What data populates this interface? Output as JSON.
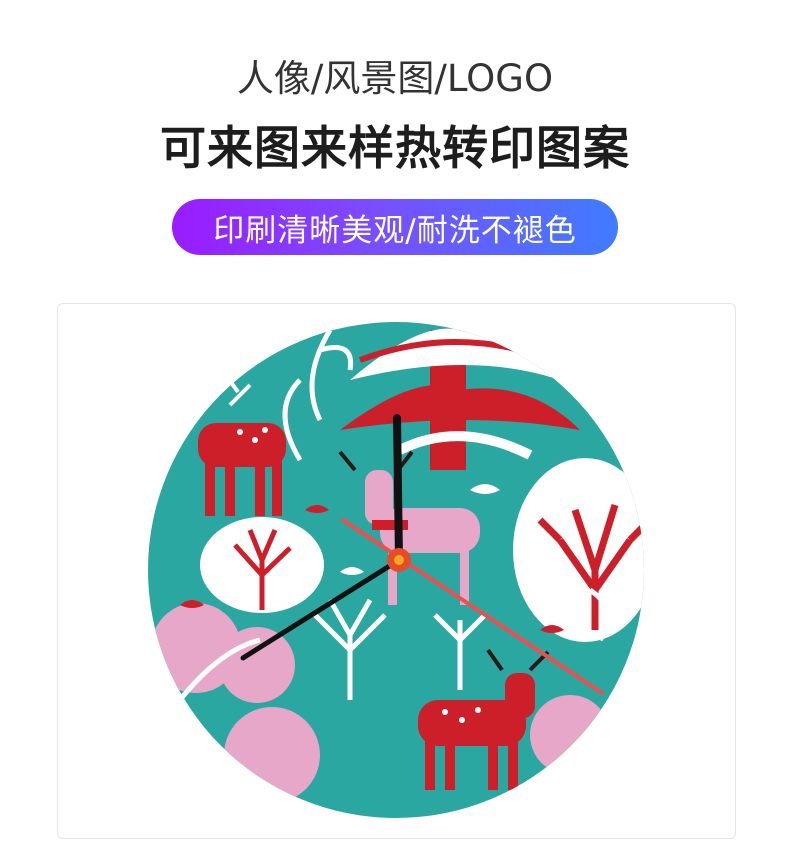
{
  "header": {
    "subtitle": "人像/风景图/LOGO",
    "title": "可来图来样热转印图案",
    "badge": "印刷清晰美观/耐洗不褪色"
  },
  "colors": {
    "teal": "#2aa7a0",
    "red": "#cc1f2a",
    "pink": "#e7a7c8",
    "white": "#ffffff",
    "pill_start": "#9a1bff",
    "pill_end": "#3f7cff"
  },
  "clock": {
    "hands_color": "#111111",
    "second_hand_color": "#ef4e4e"
  }
}
